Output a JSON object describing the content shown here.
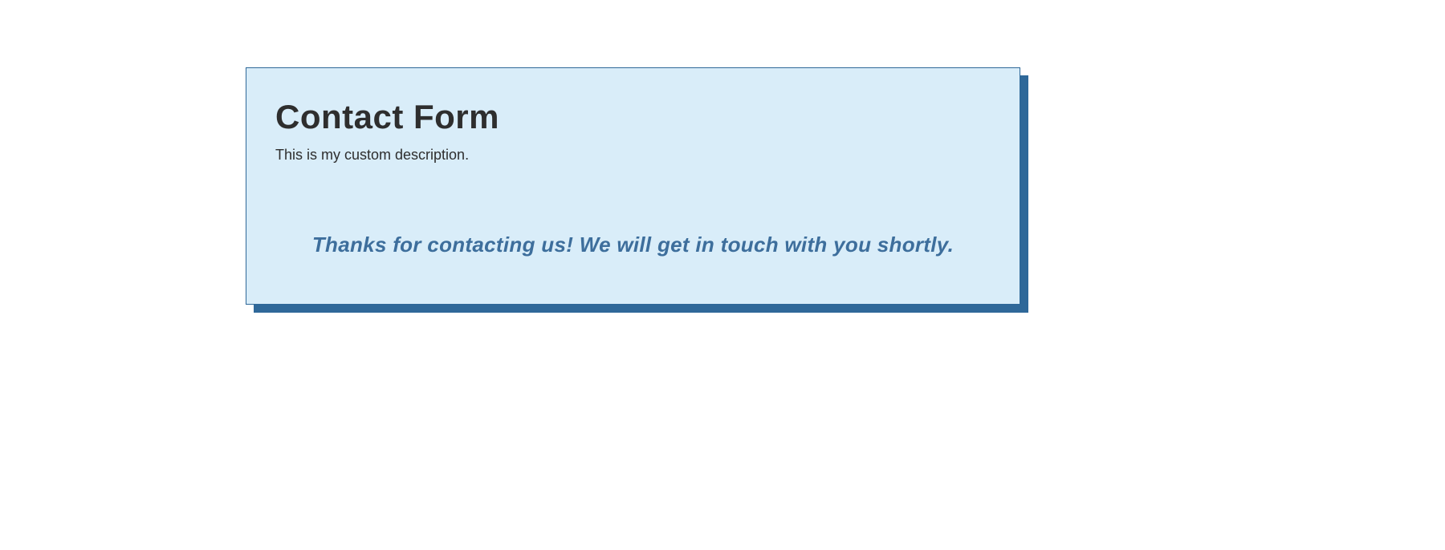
{
  "form": {
    "title": "Contact Form",
    "description": "This is my custom description.",
    "confirmation": "Thanks for contacting us! We will get in touch with you shortly."
  }
}
